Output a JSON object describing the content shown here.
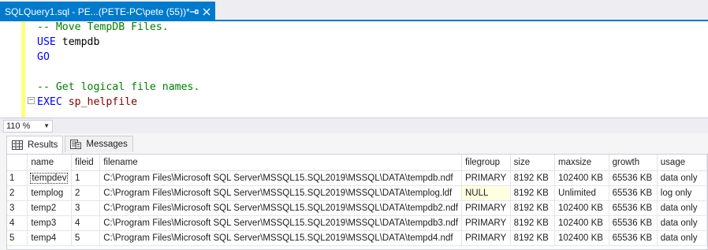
{
  "document_tab": {
    "title": "SQLQuery1.sql - PE...(PETE-PC\\pete (55))*",
    "pin_icon": "pin-icon",
    "close_icon": "close-icon"
  },
  "editor": {
    "lines": [
      {
        "parts": [
          {
            "cls": "cmt",
            "text": "-- Move TempDB Files."
          }
        ]
      },
      {
        "parts": [
          {
            "cls": "kw",
            "text": "USE"
          },
          {
            "cls": "plain",
            "text": " tempdb"
          }
        ]
      },
      {
        "parts": [
          {
            "cls": "kw",
            "text": "GO"
          }
        ]
      },
      {
        "parts": []
      },
      {
        "parts": [
          {
            "cls": "cmt",
            "text": "-- Get logical file names."
          }
        ]
      },
      {
        "parts": [
          {
            "cls": "kw",
            "text": "EXEC"
          },
          {
            "cls": "plain",
            "text": " "
          },
          {
            "cls": "proc",
            "text": "sp_helpfile"
          }
        ]
      }
    ]
  },
  "zoom": {
    "value": "110 %"
  },
  "result_tabs": [
    {
      "label": "Results",
      "icon": "grid-icon",
      "active": true
    },
    {
      "label": "Messages",
      "icon": "messages-icon",
      "active": false
    }
  ],
  "results": {
    "columns": [
      "name",
      "fileid",
      "filename",
      "filegroup",
      "size",
      "maxsize",
      "growth",
      "usage"
    ],
    "rows": [
      {
        "num": "1",
        "cells": [
          "tempdev",
          "1",
          "C:\\Program Files\\Microsoft SQL Server\\MSSQL15.SQL2019\\MSSQL\\DATA\\tempdb.ndf",
          "PRIMARY",
          "8192 KB",
          "102400 KB",
          "65536 KB",
          "data only"
        ]
      },
      {
        "num": "2",
        "cells": [
          "templog",
          "2",
          "C:\\Program Files\\Microsoft SQL Server\\MSSQL15.SQL2019\\MSSQL\\DATA\\templog.ldf",
          "NULL",
          "8192 KB",
          "Unlimited",
          "65536 KB",
          "log only"
        ]
      },
      {
        "num": "3",
        "cells": [
          "temp2",
          "3",
          "C:\\Program Files\\Microsoft SQL Server\\MSSQL15.SQL2019\\MSSQL\\DATA\\tempdb2.ndf",
          "PRIMARY",
          "8192 KB",
          "102400 KB",
          "65536 KB",
          "data only"
        ]
      },
      {
        "num": "4",
        "cells": [
          "temp3",
          "4",
          "C:\\Program Files\\Microsoft SQL Server\\MSSQL15.SQL2019\\MSSQL\\DATA\\tempdb3.ndf",
          "PRIMARY",
          "8192 KB",
          "102400 KB",
          "65536 KB",
          "data only"
        ]
      },
      {
        "num": "5",
        "cells": [
          "temp4",
          "5",
          "C:\\Program Files\\Microsoft SQL Server\\MSSQL15.SQL2019\\MSSQL\\DATA\\tempd4.ndf",
          "PRIMARY",
          "8192 KB",
          "102400 KB",
          "65536 KB",
          "data only"
        ]
      }
    ]
  },
  "colors": {
    "accent": "#007acc",
    "comment": "#008000",
    "keyword": "#0000ff",
    "procedure": "#800000",
    "null_highlight": "#ffffe1"
  }
}
